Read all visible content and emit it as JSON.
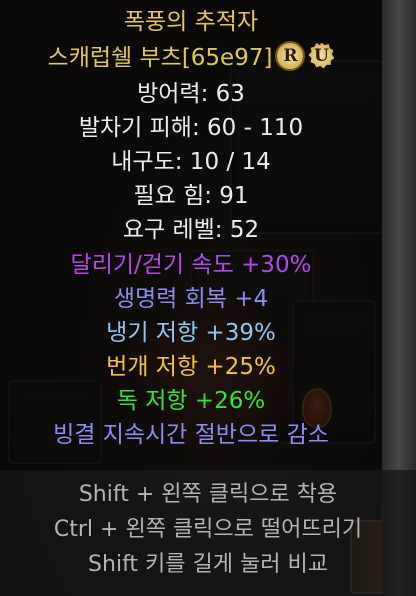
{
  "tooltip": {
    "name": "폭풍의 추적자",
    "base_type": "스캐럽쉘 부츠[65e97]",
    "badge_r": "R",
    "badge_u": "U",
    "stats": [
      {
        "text": "방어력: 63",
        "color": "white"
      },
      {
        "text": "발차기 피해: 60 - 110",
        "color": "white"
      },
      {
        "text": "내구도: 10 / 14",
        "color": "white"
      },
      {
        "text": "필요 힘: 91",
        "color": "white"
      },
      {
        "text": "요구 레벨: 52",
        "color": "white"
      },
      {
        "text": "달리기/걷기 속도 +30%",
        "color": "purple"
      },
      {
        "text": "생명력 회복 +4",
        "color": "blue"
      },
      {
        "text": "냉기 저항 +39%",
        "color": "cyan"
      },
      {
        "text": "번개 저항 +25%",
        "color": "orange"
      },
      {
        "text": "독 저항 +26%",
        "color": "green"
      },
      {
        "text": "빙결 지속시간 절반으로 감소",
        "color": "blue"
      }
    ]
  },
  "hints": [
    "Shift + 왼쪽 클릭으로 착용",
    "Ctrl + 왼쪽 클릭으로 떨어뜨리기",
    "Shift 키를 길게 눌러 비교"
  ],
  "colors": {
    "unique_gold": "#e2c656",
    "white": "#ececec",
    "purple": "#b14ae8",
    "blue": "#8a8cf0",
    "cyan": "#8ec7f2",
    "orange": "#f2c33a",
    "green": "#34e62f",
    "hint_gray": "#b4b4b4"
  }
}
